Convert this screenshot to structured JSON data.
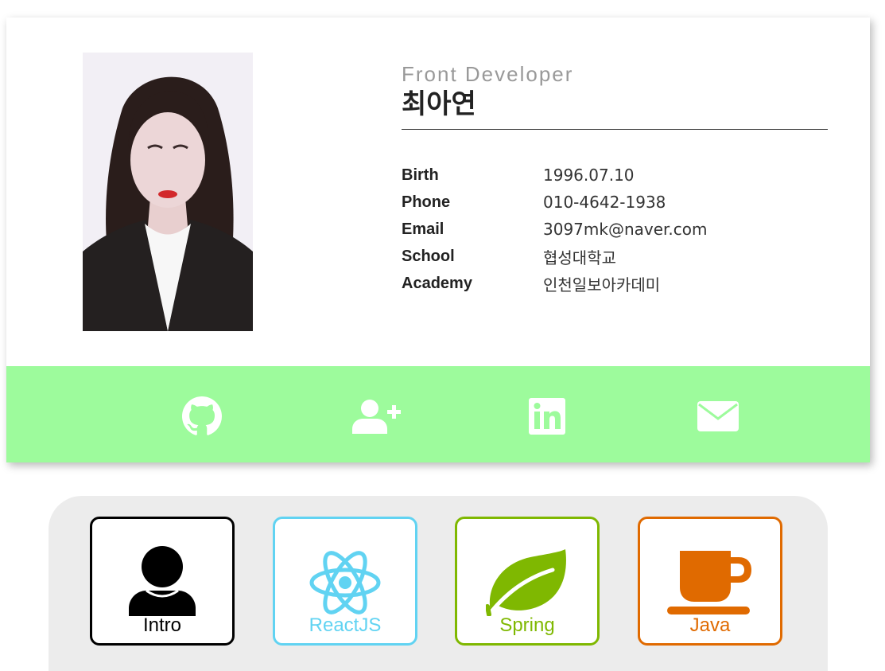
{
  "profile": {
    "role": "Front Developer",
    "name": "최아연",
    "photo_alt": "profile-photo"
  },
  "details": [
    {
      "label": "Birth",
      "value": "1996.07.10"
    },
    {
      "label": "Phone",
      "value": "010-4642-1938"
    },
    {
      "label": "Email",
      "value": "3097mk@naver.com"
    },
    {
      "label": "School",
      "value": "협성대학교"
    },
    {
      "label": "Academy",
      "value": "인천일보아카데미"
    }
  ],
  "social": {
    "background": "#9dfb9c",
    "icons": [
      "github-icon",
      "add-user-icon",
      "linkedin-icon",
      "mail-icon"
    ]
  },
  "skills": [
    {
      "label": "Intro",
      "color": "#000000",
      "icon": "user-icon"
    },
    {
      "label": "ReactJS",
      "color": "#61d3f2",
      "icon": "react-icon"
    },
    {
      "label": "Spring",
      "color": "#7fb801",
      "icon": "spring-leaf-icon"
    },
    {
      "label": "Java",
      "color": "#e06a00",
      "icon": "coffee-cup-icon"
    }
  ]
}
